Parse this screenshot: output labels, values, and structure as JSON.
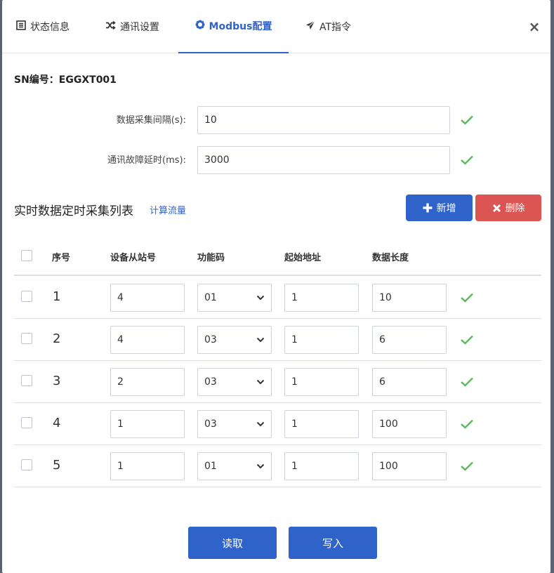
{
  "tabs": [
    {
      "label": "状态信息",
      "icon": "list-icon"
    },
    {
      "label": "通讯设置",
      "icon": "shuffle-icon"
    },
    {
      "label": "Modbus配置",
      "icon": "gear-icon"
    },
    {
      "label": "AT指令",
      "icon": "send-icon"
    }
  ],
  "active_tab": "Modbus配置",
  "close_label": "×",
  "sn": "SN编号：EGGXT001",
  "form": {
    "interval_label": "数据采集间隔(s):",
    "interval_value": "10",
    "timeout_label": "通讯故障延时(ms):",
    "timeout_value": "3000"
  },
  "section": {
    "title": "实时数据定时采集列表",
    "calc_link": "计算流量",
    "add_label": "新增",
    "delete_label": "删除"
  },
  "table": {
    "headers": [
      "序号",
      "设备从站号",
      "功能码",
      "起始地址",
      "数据长度"
    ],
    "rows": [
      {
        "index": "1",
        "slave": "4",
        "func": "01",
        "start": "1",
        "length": "10"
      },
      {
        "index": "2",
        "slave": "4",
        "func": "03",
        "start": "1",
        "length": "6"
      },
      {
        "index": "3",
        "slave": "2",
        "func": "03",
        "start": "1",
        "length": "6"
      },
      {
        "index": "4",
        "slave": "1",
        "func": "03",
        "start": "1",
        "length": "100"
      },
      {
        "index": "5",
        "slave": "1",
        "func": "01",
        "start": "1",
        "length": "100"
      }
    ]
  },
  "actions": {
    "read_label": "读取",
    "write_label": "写入"
  },
  "colors": {
    "primary": "#2f63c9",
    "danger": "#dc5552",
    "success": "#5cb85c"
  }
}
